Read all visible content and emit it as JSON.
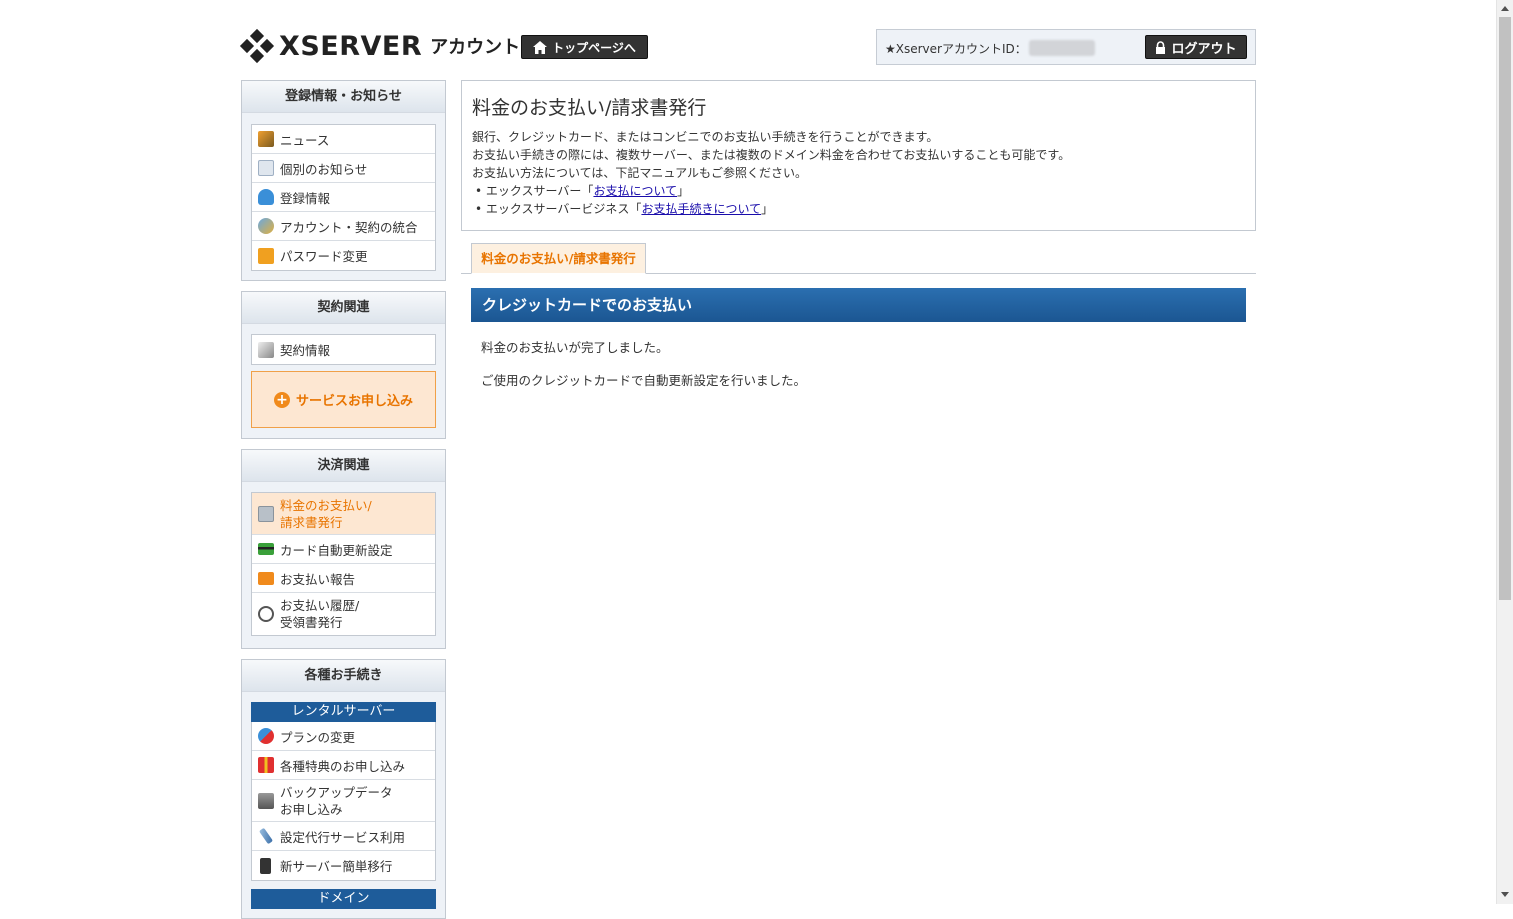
{
  "header": {
    "logo_text": "XSERVER",
    "logo_sub": "アカウント",
    "top_button": "トップページへ",
    "account_label": "★XserverアカウントID：",
    "logout_button": "ログアウト"
  },
  "sidebar": {
    "registration": {
      "title": "登録情報・お知らせ",
      "items": [
        "ニュース",
        "個別のお知らせ",
        "登録情報",
        "アカウント・契約の統合",
        "パスワード変更"
      ]
    },
    "contract": {
      "title": "契約関連",
      "items": [
        "契約情報"
      ],
      "apply_button": "サービスお申し込み"
    },
    "payment": {
      "title": "決済関連",
      "items": [
        {
          "line1": "料金のお支払い/",
          "line2": "請求書発行"
        },
        {
          "line1": "カード自動更新設定"
        },
        {
          "line1": "お支払い報告"
        },
        {
          "line1": "お支払い履歴/",
          "line2": "受領書発行"
        }
      ]
    },
    "procedures": {
      "title": "各種お手続き",
      "rental_head": "レンタルサーバー",
      "items": [
        {
          "line1": "プランの変更"
        },
        {
          "line1": "各種特典のお申し込み"
        },
        {
          "line1": "バックアップデータ",
          "line2": "お申し込み"
        },
        {
          "line1": "設定代行サービス利用"
        },
        {
          "line1": "新サーバー簡単移行"
        }
      ],
      "domain_head": "ドメイン"
    }
  },
  "main": {
    "title": "料金のお支払い/請求書発行",
    "lines": [
      "銀行、クレジットカード、またはコンビニでのお支払い手続きを行うことができます。",
      "お支払い手続きの際には、複数サーバー、または複数のドメイン料金を合わせてお支払いすることも可能です。",
      "お支払い方法については、下記マニュアルもご参照ください。"
    ],
    "bullets": [
      {
        "prefix": "エックスサーバー「",
        "link": "お支払について",
        "suffix": "」"
      },
      {
        "prefix": "エックスサーバービジネス「",
        "link": "お支払手続きについて",
        "suffix": "」"
      }
    ],
    "tab": "料金のお支払い/請求書発行",
    "section_title": "クレジットカードでのお支払い",
    "message1": "料金のお支払いが完了しました。",
    "message2": "ご使用のクレジットカードで自動更新設定を行いました。"
  },
  "colors": {
    "accent_orange": "#e87400",
    "section_blue": "#1b5692",
    "sidebar_bg": "#eef2f7"
  }
}
